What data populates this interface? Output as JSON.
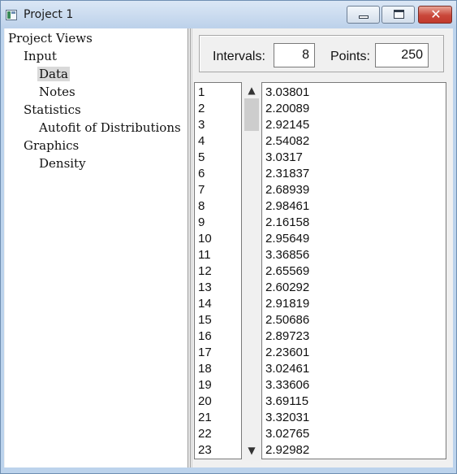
{
  "window": {
    "title": "Project 1"
  },
  "tree": {
    "root": "Project Views",
    "input": "Input",
    "data": "Data",
    "notes": "Notes",
    "statistics": "Statistics",
    "autofit": "Autofit of Distributions",
    "graphics": "Graphics",
    "density": "Density"
  },
  "params": {
    "intervals_label": "Intervals:",
    "intervals_value": "8",
    "points_label": "Points:",
    "points_value": "250"
  },
  "table": {
    "indices": [
      "1",
      "2",
      "3",
      "4",
      "5",
      "6",
      "7",
      "8",
      "9",
      "10",
      "11",
      "12",
      "13",
      "14",
      "15",
      "16",
      "17",
      "18",
      "19",
      "20",
      "21",
      "22",
      "23"
    ],
    "values": [
      "3.03801",
      "2.20089",
      "2.92145",
      "2.54082",
      "3.0317",
      "2.31837",
      "2.68939",
      "2.98461",
      "2.16158",
      "2.95649",
      "3.36856",
      "2.65569",
      "2.60292",
      "2.91819",
      "2.50686",
      "2.89723",
      "2.23601",
      "3.02461",
      "3.33606",
      "3.69115",
      "3.32031",
      "3.02765",
      "2.92982"
    ]
  },
  "icons": {
    "up": "▲",
    "down": "▼"
  }
}
